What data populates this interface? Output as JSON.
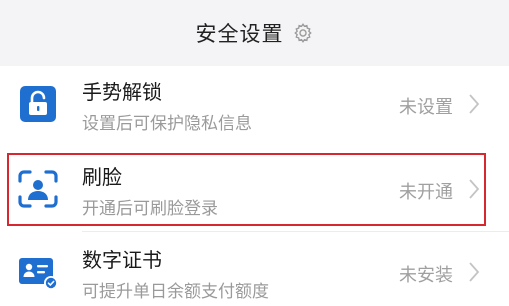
{
  "header": {
    "title": "安全设置"
  },
  "items": [
    {
      "title": "手势解锁",
      "subtitle": "设置后可保护隐私信息",
      "status": "未设置",
      "icon": "lock-icon"
    },
    {
      "title": "刷脸",
      "subtitle": "开通后可刷脸登录",
      "status": "未开通",
      "icon": "face-scan-icon"
    },
    {
      "title": "数字证书",
      "subtitle": "可提升单日余额支付额度",
      "status": "未安装",
      "icon": "digital-certificate-icon"
    }
  ],
  "colors": {
    "accent": "#1f6fd1",
    "highlight": "#d8282f",
    "header_bg": "#f4f4f6"
  }
}
